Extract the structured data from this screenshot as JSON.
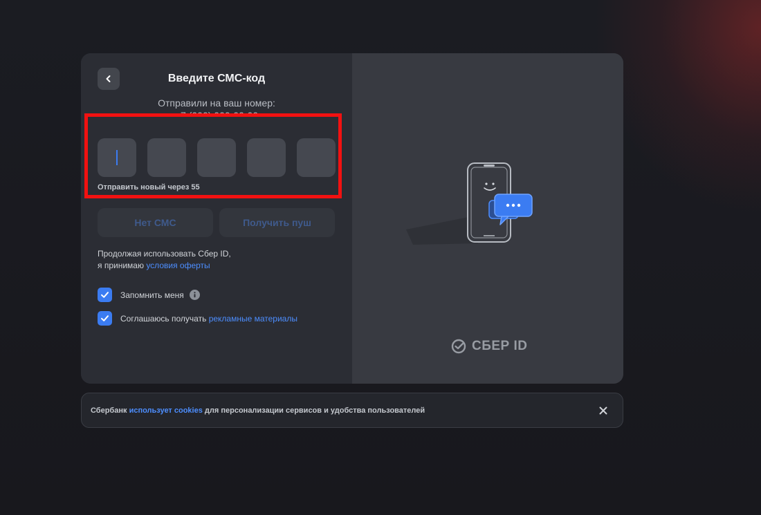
{
  "header": {
    "back_icon": "chevron-left-icon",
    "title": "Введите СМС-код",
    "subtitle": "Отправили на ваш номер:",
    "phone": "+7 (000) 000-00-00"
  },
  "code": {
    "boxes": [
      "",
      "",
      "",
      "",
      ""
    ],
    "active_index": 0,
    "resend_text": "Отправить новый через 55"
  },
  "buttons": {
    "no_sms": "Нет СМС",
    "get_push": "Получить пуш"
  },
  "terms": {
    "line1": "Продолжая использовать Сбер ID,",
    "line2_prefix": "я принимаю",
    "link": "условия оферты"
  },
  "checkboxes": {
    "remember_me": {
      "label": "Запомнить меня",
      "checked": true,
      "icon": "info-icon"
    },
    "ads": {
      "label_prefix": "Соглашаюсь получать",
      "link": "рекламные материалы",
      "checked": true
    }
  },
  "brand": {
    "name": "СБЕР ID",
    "icon": "sber-check-icon"
  },
  "cookie": {
    "prefix": "Сбербанк",
    "link": "использует cookies",
    "suffix": "для персонализации сервисов и удобства пользователей",
    "close_icon": "close-icon"
  },
  "colors": {
    "accent": "#3b7cf2",
    "link": "#4d8eff",
    "highlight": "#f21111",
    "card_left": "#2b2d34",
    "card_right": "#383a41"
  }
}
